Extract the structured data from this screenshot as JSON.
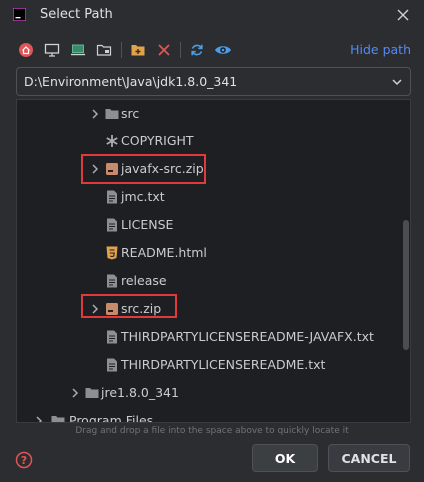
{
  "window": {
    "title": "Select Path",
    "close_icon": "close-icon"
  },
  "toolbar": {
    "icons": [
      "home-icon",
      "desktop-icon",
      "computer-icon",
      "network-folder-icon",
      "new-folder-icon",
      "delete-icon",
      "refresh-icon",
      "show-hidden-icon"
    ],
    "hide_path_label": "Hide path"
  },
  "path": {
    "value": "D:\\Environment\\Java\\jdk1.8.0_341"
  },
  "tree": {
    "items": [
      {
        "label": "src",
        "type": "folder",
        "expandable": true
      },
      {
        "label": "COPYRIGHT",
        "type": "file-asterisk",
        "expandable": false
      },
      {
        "label": "javafx-src.zip",
        "type": "archive",
        "expandable": true,
        "highlighted": true
      },
      {
        "label": "jmc.txt",
        "type": "text",
        "expandable": false
      },
      {
        "label": "LICENSE",
        "type": "text",
        "expandable": false
      },
      {
        "label": "README.html",
        "type": "html",
        "expandable": false
      },
      {
        "label": "release",
        "type": "text",
        "expandable": false
      },
      {
        "label": "src.zip",
        "type": "archive",
        "expandable": true,
        "highlighted": true
      },
      {
        "label": "THIRDPARTYLICENSEREADME-JAVAFX.txt",
        "type": "text",
        "expandable": false
      },
      {
        "label": "THIRDPARTYLICENSEREADME.txt",
        "type": "text",
        "expandable": false
      },
      {
        "label": "jre1.8.0_341",
        "type": "folder",
        "expandable": true
      },
      {
        "label": "Program Files",
        "type": "folder",
        "expandable": true
      }
    ]
  },
  "hint": "Drag and drop a file into the space above to quickly locate it",
  "buttons": {
    "ok": "OK",
    "cancel": "CANCEL"
  },
  "colors": {
    "accent": "#548af7",
    "highlight_border": "#e23a3a",
    "folder": "#8c8f94",
    "archive": "#c98a6b",
    "html_icon": "#e3a24a"
  }
}
